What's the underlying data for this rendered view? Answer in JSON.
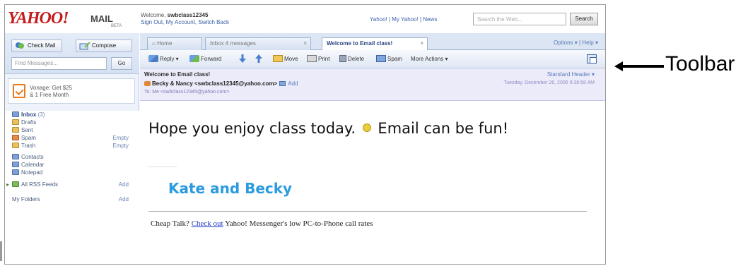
{
  "header": {
    "logo": "YAHOO!",
    "product": "MAIL",
    "beta": "BETA",
    "welcome_prefix": "Welcome, ",
    "username": "swbclass12345",
    "account_links": "Sign Out, My Account, Switch Back",
    "top_links": "Yahoo! | My Yahoo! | News",
    "search_placeholder": "Search the Web...",
    "search_button": "Search"
  },
  "sidebar": {
    "check_mail": "Check Mail",
    "compose": "Compose",
    "find_placeholder": "Find Messages...",
    "go": "Go",
    "ad_line1": "Vonage: Get $25",
    "ad_line2": "& 1 Free Month",
    "folders": [
      {
        "label": "Inbox",
        "count": "(3)",
        "action": ""
      },
      {
        "label": "Drafts",
        "count": "",
        "action": ""
      },
      {
        "label": "Sent",
        "count": "",
        "action": ""
      },
      {
        "label": "Spam",
        "count": "",
        "action": "Empty"
      },
      {
        "label": "Trash",
        "count": "",
        "action": "Empty"
      },
      {
        "label": "Contacts",
        "count": "",
        "action": ""
      },
      {
        "label": "Calendar",
        "count": "",
        "action": ""
      },
      {
        "label": "Notepad",
        "count": "",
        "action": ""
      },
      {
        "label": "All RSS Feeds",
        "count": "",
        "action": "Add"
      },
      {
        "label": "My Folders",
        "count": "",
        "action": "Add"
      }
    ]
  },
  "tabs": [
    {
      "label": "Home"
    },
    {
      "label": "Inbox 4 messages"
    },
    {
      "label": "Welcome to Email class!"
    }
  ],
  "options_links": "Options ▾ | Help ▾",
  "toolbar": {
    "reply": "Reply ▾",
    "forward": "Forward",
    "move": "Move",
    "print": "Print",
    "delete": "Delete",
    "spam": "Spam",
    "more_actions": "More Actions ▾"
  },
  "message": {
    "subject": "Welcome to Email class!",
    "from": "Becky & Nancy <swbclass12345@yahoo.com>",
    "add": "Add",
    "to": "To: Me <swbclass12345@yahoo.com>",
    "header_mode": "Standard Header ▾",
    "date": "Tuesday, December 26, 2006 9:38:58 AM",
    "body_text_1": "Hope you enjoy class today.",
    "body_text_2": "Email can be fun!",
    "signature": "Kate and Becky",
    "footer_prefix": "Cheap Talk? ",
    "footer_link": "Check out",
    "footer_suffix": " Yahoo! Messenger's low PC-to-Phone call rates"
  },
  "annotation": {
    "label": "Toolbar"
  }
}
